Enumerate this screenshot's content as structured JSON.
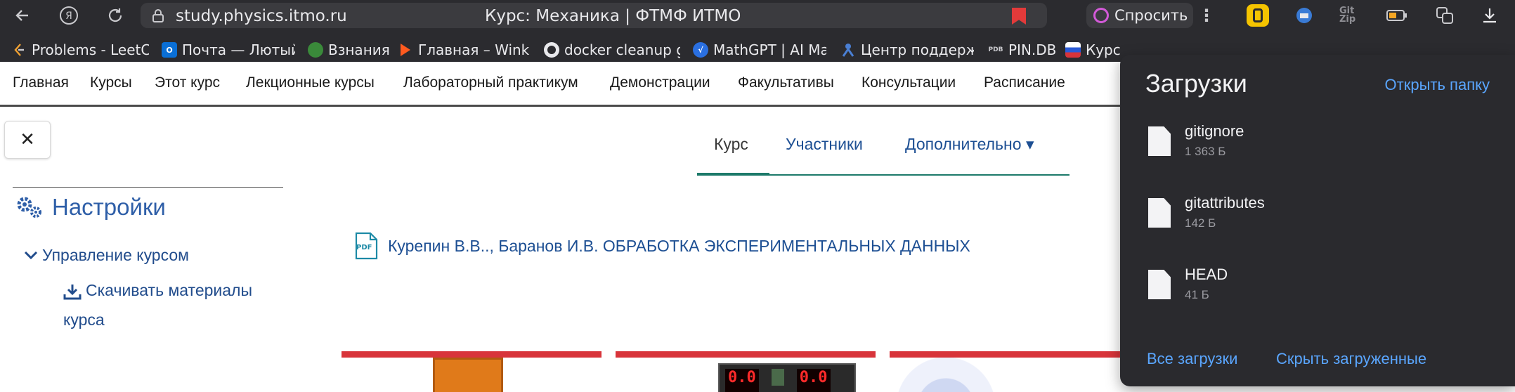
{
  "browser": {
    "url": "study.physics.itmo.ru",
    "page_title": "Курс: Механика | ФТМФ ИТМО",
    "ask_label": "Спросить",
    "ext_gitzip": "Git Zip"
  },
  "bookmarks": [
    {
      "label": "Problems - LeetCo",
      "icon": "leetcode-icon",
      "color": "#2b2b2f"
    },
    {
      "label": "Почта — Лютый Н",
      "icon": "outlook-icon",
      "color": "#0a6fd6"
    },
    {
      "label": "Взнания",
      "icon": "globe-icon",
      "color": "#3a8a3a"
    },
    {
      "label": "Главная – Wink – ",
      "icon": "wink-icon",
      "color": "#ff5a1f"
    },
    {
      "label": "docker cleanup gu",
      "icon": "github-icon",
      "color": "#2b2b2f"
    },
    {
      "label": "MathGPT | AI Math",
      "icon": "mathgpt-icon",
      "color": "#2a6fe0"
    },
    {
      "label": "Центр поддержки",
      "icon": "person-icon",
      "color": "#2b2b2f"
    },
    {
      "label": "PIN.DB",
      "icon": "pdb-icon",
      "color": "#2b2b2f",
      "badge": "PDB"
    },
    {
      "label": "Курс: М",
      "icon": "flag-icon",
      "color": "#d8343a"
    }
  ],
  "site_nav": [
    "Главная",
    "Курсы",
    "Этот курс",
    "Лекционные курсы",
    "Лабораторный практикум",
    "Демонстрации",
    "Факультативы",
    "Консультации",
    "Расписание"
  ],
  "page": {
    "close_label": "✕",
    "settings_title": "Настройки",
    "course_management": "Управление курсом",
    "download_materials": "Скачивать материалы курса",
    "tabs": [
      "Курс",
      "Участники",
      "Дополнительно"
    ],
    "dropdown_caret": "▾",
    "pdf_badge": "PDF",
    "pdf_title": "Курепин В.В.., Баранов И.В. ОБРАБОТКА ЭКСПЕРИМЕНТАЛЬНЫХ ДАННЫХ",
    "card2_digits": [
      "0.0",
      "0.0"
    ]
  },
  "downloads": {
    "title": "Загрузки",
    "open_folder": "Открыть папку",
    "items": [
      {
        "name": "gitignore",
        "size": "1 363 Б"
      },
      {
        "name": "gitattributes",
        "size": "142 Б"
      },
      {
        "name": "HEAD",
        "size": "41 Б"
      }
    ],
    "all_downloads": "Все загрузки",
    "hide_downloaded": "Скрыть загруженные"
  },
  "colors": {
    "link": "#1d4f93",
    "accent_teal": "#1d7a6a",
    "card_red": "#d8343a",
    "panel_link": "#5aa6ff"
  }
}
